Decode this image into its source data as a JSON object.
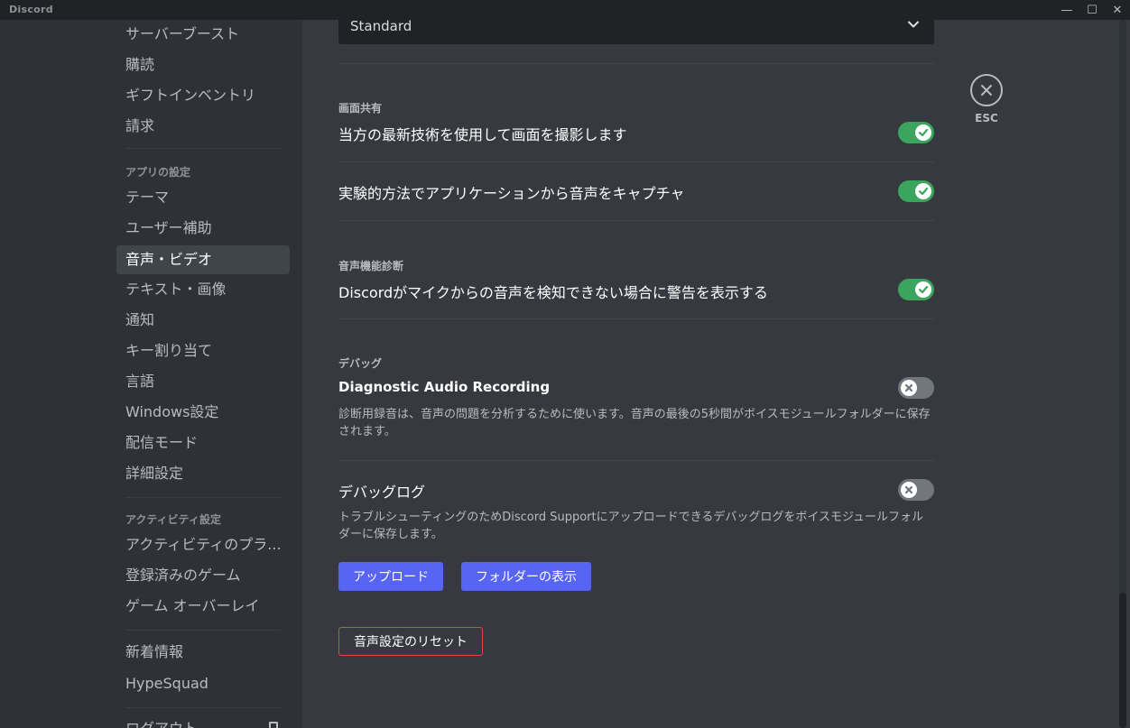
{
  "window": {
    "title": "Discord",
    "minimize": "—",
    "maximize": "☐",
    "close": "✕"
  },
  "sidebar": {
    "items_top": [
      "サーバーブースト",
      "購読",
      "ギフトインベントリ",
      "請求"
    ],
    "app_settings_header": "アプリの設定",
    "app_settings": [
      "テーマ",
      "ユーザー補助",
      "音声・ビデオ",
      "テキスト・画像",
      "通知",
      "キー割り当て",
      "言語",
      "Windows設定",
      "配信モード",
      "詳細設定"
    ],
    "selected": "音声・ビデオ",
    "activity_header": "アクティビティ設定",
    "activity_settings": [
      "アクティビティのプラ...",
      "登録済みのゲーム",
      "ゲーム オーバーレイ"
    ],
    "misc": [
      "新着情報",
      "HypeSquad"
    ],
    "logout": "ログアウト"
  },
  "main": {
    "dropdown_value": "Standard",
    "screen_share": {
      "title": "画面共有",
      "setting1": "当方の最新技術を使用して画面を撮影します",
      "setting2": "実験的方法でアプリケーションから音声をキャプチャ"
    },
    "diagnostics": {
      "title": "音声機能診断",
      "setting": "Discordがマイクからの音声を検知できない場合に警告を表示する"
    },
    "debug": {
      "title": "デバッグ",
      "audio_recording_label": "Diagnostic Audio Recording",
      "audio_recording_desc": "診断用録音は、音声の問題を分析するために使います。音声の最後の5秒間がボイスモジュールフォルダーに保存されます。",
      "debug_log_label": "デバッグログ",
      "debug_log_desc": "トラブルシューティングのためDiscord Supportにアップロードできるデバッグログをボイスモジュールフォルダーに保存します。",
      "upload_button": "アップロード",
      "show_folder_button": "フォルダーの表示"
    },
    "reset_button": "音声設定のリセット",
    "esc_label": "ESC"
  },
  "toggles": {
    "screen_capture": true,
    "app_audio_capture": true,
    "mic_warning": true,
    "diagnostic_recording": false,
    "debug_log": false
  },
  "colors": {
    "accent": "#5865f2",
    "toggle_on": "#3ba55d",
    "toggle_off": "#72767d",
    "danger": "#ed4245"
  }
}
